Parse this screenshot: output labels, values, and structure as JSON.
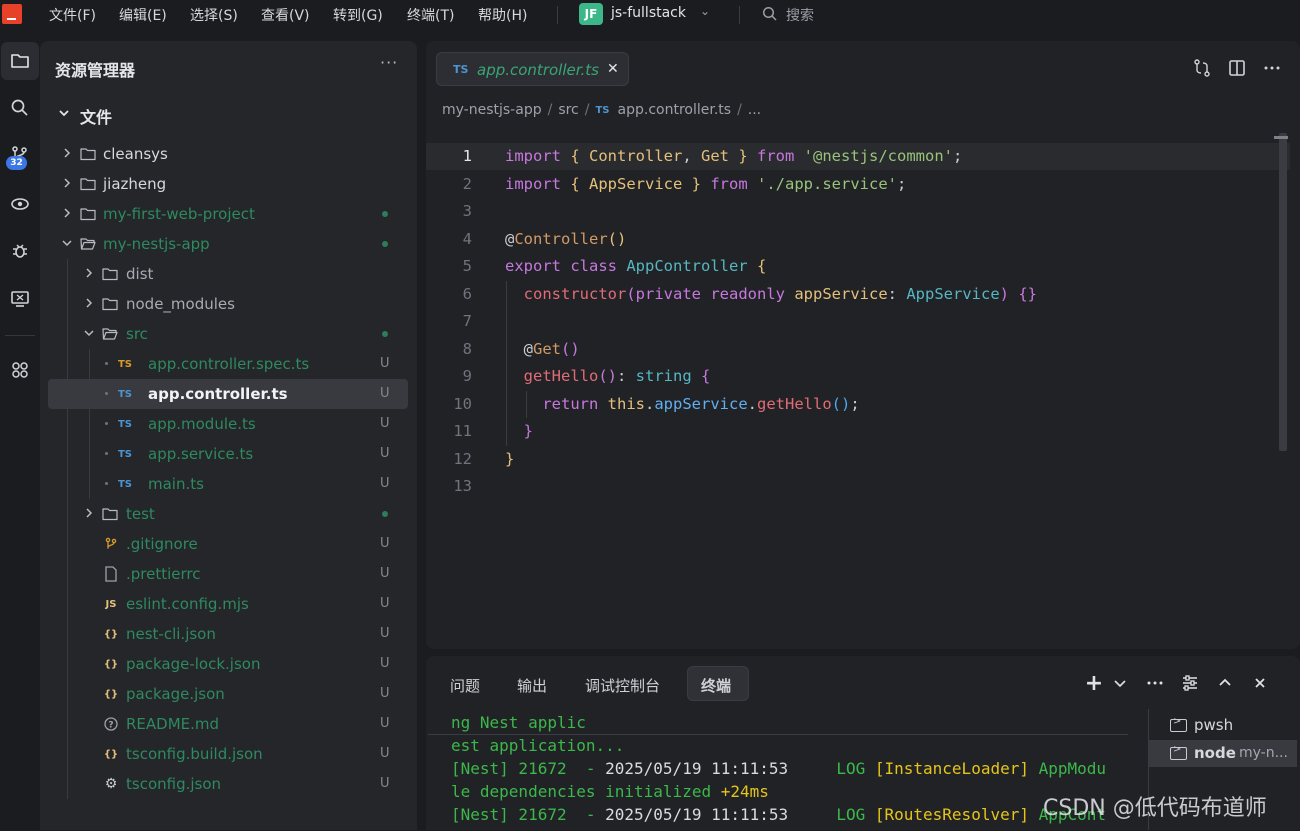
{
  "menubar": {
    "items": [
      "文件(F)",
      "编辑(E)",
      "选择(S)",
      "查看(V)",
      "转到(G)",
      "终端(T)",
      "帮助(H)"
    ],
    "project_badge": "JF",
    "project_name": "js-fullstack",
    "search_label": "搜索"
  },
  "activitybar": {
    "icons": [
      "explorer-icon",
      "search-icon",
      "source-control-icon",
      "remote-explorer-icon",
      "debug-icon",
      "remote-display-icon",
      "extensions-icon"
    ],
    "scm_badge": "32"
  },
  "sidebar": {
    "title": "资源管理器",
    "more": "···",
    "section_title": "文件",
    "tree": [
      {
        "label": "cleansys",
        "type": "folder",
        "state": "closed",
        "depth": 0,
        "color": "#d6d8dd",
        "status": ""
      },
      {
        "label": "jiazheng",
        "type": "folder",
        "state": "closed",
        "depth": 0,
        "color": "#d6d8dd",
        "status": ""
      },
      {
        "label": "my-first-web-project",
        "type": "folder",
        "state": "closed",
        "depth": 0,
        "color": "#2e8a5f",
        "status": "dot"
      },
      {
        "label": "my-nestjs-app",
        "type": "folder",
        "state": "open",
        "depth": 0,
        "color": "#2e8a5f",
        "status": "dot"
      },
      {
        "label": "dist",
        "type": "folder",
        "state": "closed",
        "depth": 1,
        "color": "#a7abb2",
        "status": ""
      },
      {
        "label": "node_modules",
        "type": "folder",
        "state": "closed",
        "depth": 1,
        "color": "#a7abb2",
        "status": ""
      },
      {
        "label": "src",
        "type": "folder",
        "state": "open",
        "depth": 1,
        "color": "#2e8a5f",
        "status": "dot"
      },
      {
        "label": "app.controller.spec.ts",
        "type": "ts",
        "badge": "TS",
        "badge_color": "#d79b2a",
        "depth": 2,
        "color": "#2e8a5f",
        "status": "U"
      },
      {
        "label": "app.controller.ts",
        "type": "ts",
        "badge": "TS",
        "badge_color": "#4e94ce",
        "depth": 2,
        "color": "#f2f3f5",
        "status": "U",
        "selected": true
      },
      {
        "label": "app.module.ts",
        "type": "ts",
        "badge": "TS",
        "badge_color": "#4e94ce",
        "depth": 2,
        "color": "#2e8a5f",
        "status": "U"
      },
      {
        "label": "app.service.ts",
        "type": "ts",
        "badge": "TS",
        "badge_color": "#4e94ce",
        "depth": 2,
        "color": "#2e8a5f",
        "status": "U"
      },
      {
        "label": "main.ts",
        "type": "ts",
        "badge": "TS",
        "badge_color": "#4e94ce",
        "depth": 2,
        "color": "#2e8a5f",
        "status": "U"
      },
      {
        "label": "test",
        "type": "folder",
        "state": "closed",
        "depth": 1,
        "color": "#2e8a5f",
        "status": "dot"
      },
      {
        "label": ".gitignore",
        "type": "git",
        "badge": "",
        "badge_color": "#d79b2a",
        "depth": 1,
        "color": "#2e8a5f",
        "status": "U"
      },
      {
        "label": ".prettierrc",
        "type": "file",
        "badge": "",
        "badge_color": "#9da1a9",
        "depth": 1,
        "color": "#2e8a5f",
        "status": "U"
      },
      {
        "label": "eslint.config.mjs",
        "type": "js",
        "badge": "JS",
        "badge_color": "#e5c07b",
        "depth": 1,
        "color": "#2e8a5f",
        "status": "U"
      },
      {
        "label": "nest-cli.json",
        "type": "json",
        "badge": "{}",
        "badge_color": "#e5c07b",
        "depth": 1,
        "color": "#2e8a5f",
        "status": "U"
      },
      {
        "label": "package-lock.json",
        "type": "json",
        "badge": "{}",
        "badge_color": "#e5c07b",
        "depth": 1,
        "color": "#2e8a5f",
        "status": "U"
      },
      {
        "label": "package.json",
        "type": "json",
        "badge": "{}",
        "badge_color": "#e5c07b",
        "depth": 1,
        "color": "#2e8a5f",
        "status": "U"
      },
      {
        "label": "README.md",
        "type": "md",
        "badge": "?",
        "badge_color": "#9da1a9",
        "depth": 1,
        "color": "#2e8a5f",
        "status": "U"
      },
      {
        "label": "tsconfig.build.json",
        "type": "json",
        "badge": "{}",
        "badge_color": "#e5c07b",
        "depth": 1,
        "color": "#2e8a5f",
        "status": "U"
      },
      {
        "label": "tsconfig.json",
        "type": "gear",
        "badge": "⚙",
        "badge_color": "#c8cbd1",
        "depth": 1,
        "color": "#2e8a5f",
        "status": "U"
      }
    ]
  },
  "editor": {
    "tab_badge": "TS",
    "tab_label": "app.controller.ts",
    "tab_close": "✕",
    "breadcrumb": [
      "my-nestjs-app",
      "src",
      "app.controller.ts",
      "..."
    ],
    "breadcrumb_ts": "TS",
    "current_line": 1,
    "lines": [
      [
        [
          "import ",
          "kw"
        ],
        [
          "{ ",
          "b1"
        ],
        [
          "Controller",
          "id"
        ],
        [
          ", ",
          "pl"
        ],
        [
          "Get",
          "id"
        ],
        [
          " }",
          "b1"
        ],
        [
          " from ",
          "kw"
        ],
        [
          "'@nestjs/common'",
          "str"
        ],
        [
          ";",
          "pl"
        ]
      ],
      [
        [
          "import ",
          "kw"
        ],
        [
          "{ ",
          "b1"
        ],
        [
          "AppService",
          "id"
        ],
        [
          " }",
          "b1"
        ],
        [
          " from ",
          "kw"
        ],
        [
          "'./app.service'",
          "str"
        ],
        [
          ";",
          "pl"
        ]
      ],
      [],
      [
        [
          "@",
          "pl"
        ],
        [
          "Controller",
          "dec"
        ],
        [
          "()",
          "b1"
        ]
      ],
      [
        [
          "export ",
          "kw"
        ],
        [
          "class ",
          "kw"
        ],
        [
          "AppController",
          "cls"
        ],
        [
          " {",
          "b1"
        ]
      ],
      [
        [
          "  constructor",
          "fn"
        ],
        [
          "(",
          "b2"
        ],
        [
          "private ",
          "kw"
        ],
        [
          "readonly ",
          "kw"
        ],
        [
          "appService",
          "id"
        ],
        [
          ": ",
          "pl"
        ],
        [
          "AppService",
          "type"
        ],
        [
          ")",
          "b2"
        ],
        [
          " {}",
          "b2"
        ]
      ],
      [],
      [
        [
          "  @",
          "pl"
        ],
        [
          "Get",
          "dec"
        ],
        [
          "()",
          "b2"
        ]
      ],
      [
        [
          "  getHello",
          "fn"
        ],
        [
          "()",
          "b2"
        ],
        [
          ": ",
          "pl"
        ],
        [
          "string",
          "type"
        ],
        [
          " {",
          "b2"
        ]
      ],
      [
        [
          "    return ",
          "kw"
        ],
        [
          "this",
          "this"
        ],
        [
          ".",
          "pl"
        ],
        [
          "appService",
          "prop"
        ],
        [
          ".",
          "pl"
        ],
        [
          "getHello",
          "fn"
        ],
        [
          "()",
          "b3"
        ],
        [
          ";",
          "pl"
        ]
      ],
      [
        [
          "  }",
          "b2"
        ]
      ],
      [
        [
          "}",
          "b1"
        ]
      ],
      []
    ]
  },
  "panel": {
    "tabs": [
      "问题",
      "输出",
      "调试控制台",
      "终端"
    ],
    "active_tab": "终端",
    "actions": [
      "+",
      "⌄",
      "···",
      "⚌",
      "⌃",
      "✕"
    ],
    "terminal_lines": [
      [
        [
          "ng Nest applic",
          "g"
        ]
      ],
      [
        [
          "est application...",
          "g"
        ]
      ],
      [
        [
          "[Nest] 21672  - ",
          "g"
        ],
        [
          "2025/05/19 11:11:53",
          "w"
        ],
        [
          "     LOG ",
          "g"
        ],
        [
          "[InstanceLoader] ",
          "y"
        ],
        [
          "AppModu",
          "g"
        ]
      ],
      [
        [
          "le dependencies initialized ",
          "g"
        ],
        [
          "+24ms",
          "y"
        ]
      ],
      [
        [
          "[Nest] 21672  - ",
          "g"
        ],
        [
          "2025/05/19 11:11:53",
          "w"
        ],
        [
          "     LOG ",
          "g"
        ],
        [
          "[RoutesResolver] ",
          "y"
        ],
        [
          "AppCont",
          "g"
        ]
      ]
    ],
    "terminals": [
      {
        "name": "pwsh",
        "sub": ""
      },
      {
        "name": "node",
        "sub": "my-n..."
      }
    ]
  },
  "watermark": "CSDN @低代码布道师"
}
